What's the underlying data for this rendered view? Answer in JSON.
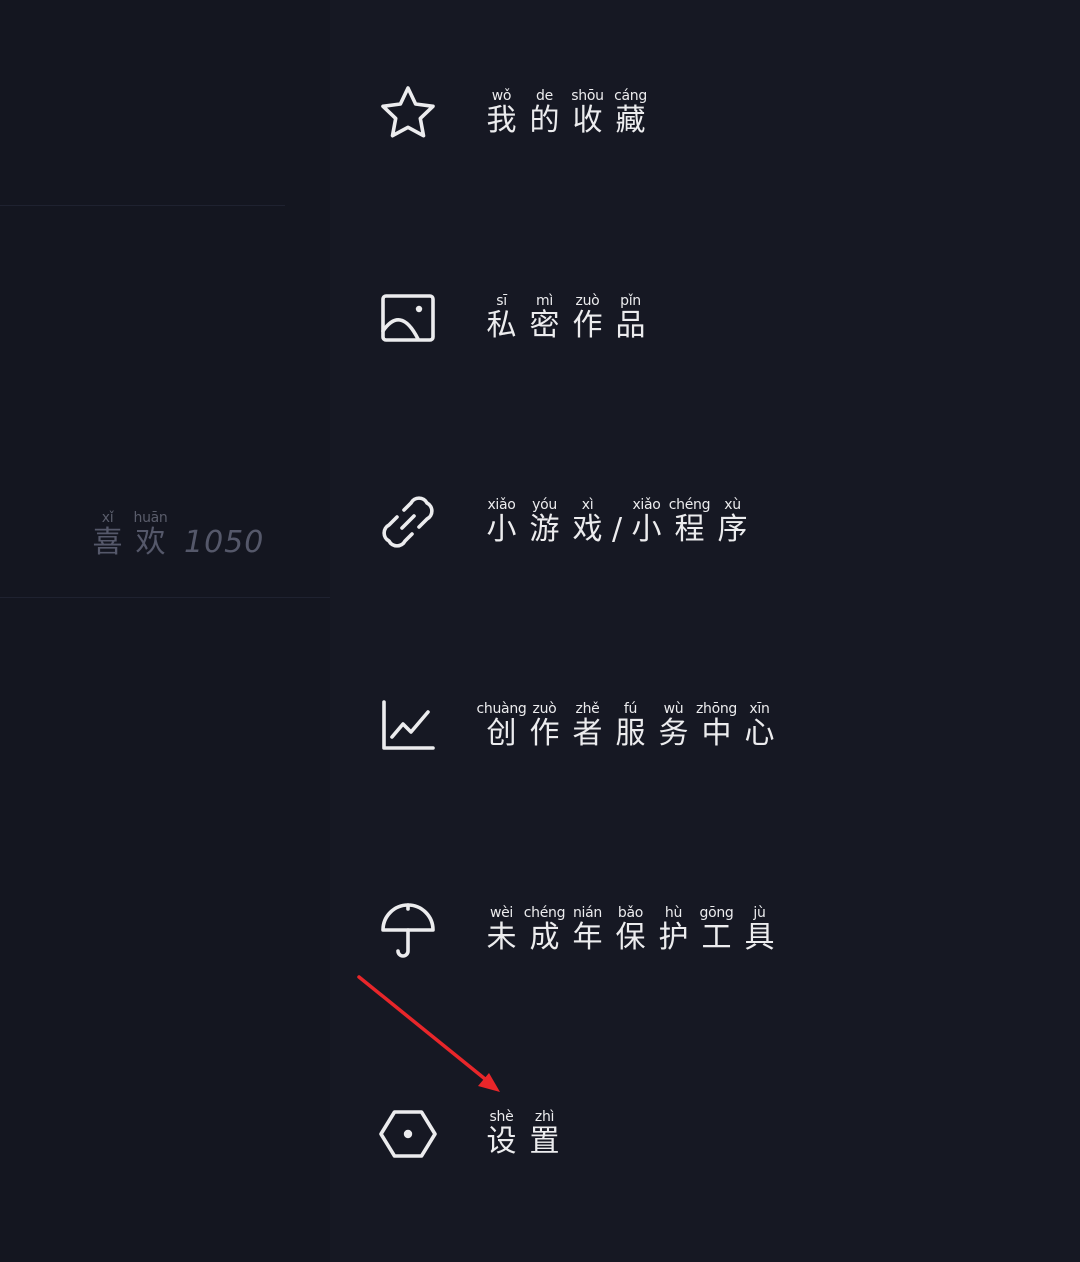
{
  "profile": {
    "likes": {
      "chars": [
        {
          "py": "xǐ",
          "hz": "喜"
        },
        {
          "py": "huān",
          "hz": "欢"
        }
      ],
      "count": "1050"
    }
  },
  "drawer": {
    "items": [
      {
        "icon": "star-icon",
        "chars": [
          {
            "py": "wǒ",
            "hz": "我"
          },
          {
            "py": "de",
            "hz": "的"
          },
          {
            "py": "shōu",
            "hz": "收"
          },
          {
            "py": "cáng",
            "hz": "藏"
          }
        ]
      },
      {
        "icon": "image-icon",
        "chars": [
          {
            "py": "sī",
            "hz": "私"
          },
          {
            "py": "mì",
            "hz": "密"
          },
          {
            "py": "zuò",
            "hz": "作"
          },
          {
            "py": "pǐn",
            "hz": "品"
          }
        ]
      },
      {
        "icon": "link-icon",
        "chars1": [
          {
            "py": "xiǎo",
            "hz": "小"
          },
          {
            "py": "yóu",
            "hz": "游"
          },
          {
            "py": "xì",
            "hz": "戏"
          }
        ],
        "separator": "/",
        "chars2": [
          {
            "py": "xiǎo",
            "hz": "小"
          },
          {
            "py": "chéng",
            "hz": "程"
          },
          {
            "py": "xù",
            "hz": "序"
          }
        ]
      },
      {
        "icon": "trend-chart-icon",
        "chars": [
          {
            "py": "chuàng",
            "hz": "创"
          },
          {
            "py": "zuò",
            "hz": "作"
          },
          {
            "py": "zhě",
            "hz": "者"
          },
          {
            "py": "fú",
            "hz": "服"
          },
          {
            "py": "wù",
            "hz": "务"
          },
          {
            "py": "zhōng",
            "hz": "中"
          },
          {
            "py": "xīn",
            "hz": "心"
          }
        ]
      },
      {
        "icon": "umbrella-icon",
        "chars": [
          {
            "py": "wèi",
            "hz": "未"
          },
          {
            "py": "chéng",
            "hz": "成"
          },
          {
            "py": "nián",
            "hz": "年"
          },
          {
            "py": "bǎo",
            "hz": "保"
          },
          {
            "py": "hù",
            "hz": "护"
          },
          {
            "py": "gōng",
            "hz": "工"
          },
          {
            "py": "jù",
            "hz": "具"
          }
        ]
      },
      {
        "icon": "settings-hexagon-icon",
        "chars": [
          {
            "py": "shè",
            "hz": "设"
          },
          {
            "py": "zhì",
            "hz": "置"
          }
        ]
      }
    ]
  },
  "colors": {
    "background": "#161823",
    "left_panel": "#141620",
    "text": "#ececee",
    "annotation_arrow": "#e8262a"
  }
}
